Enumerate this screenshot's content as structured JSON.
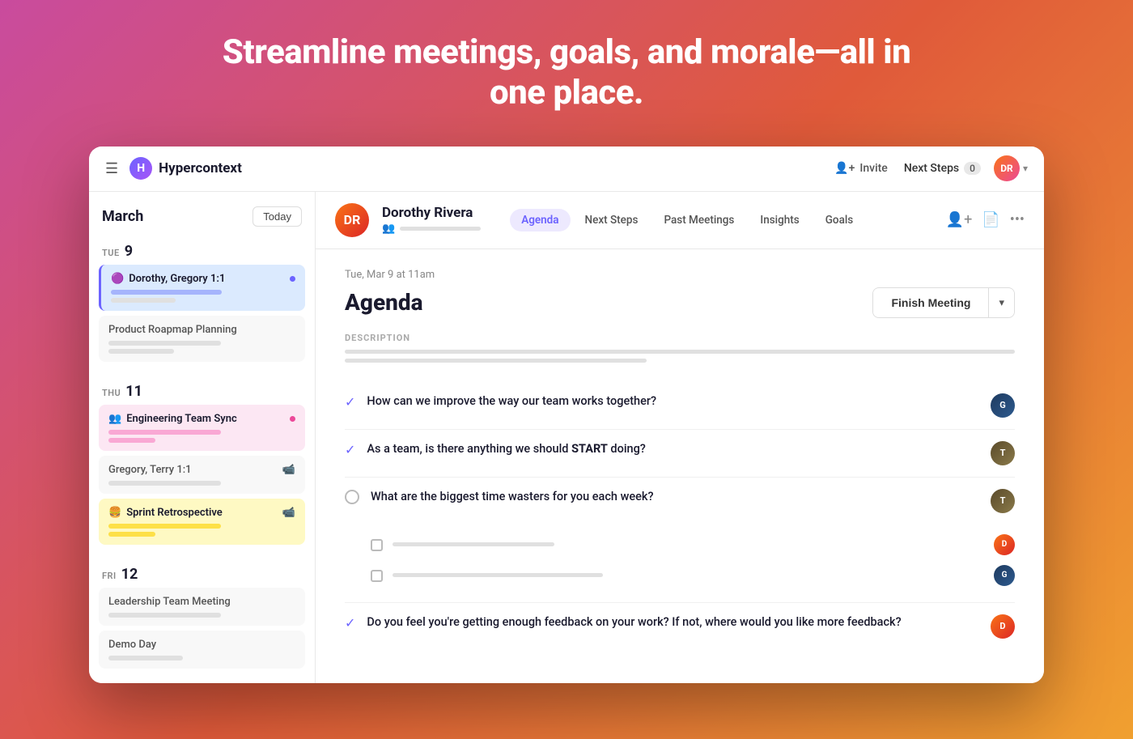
{
  "hero": {
    "title": "Streamline meetings, goals, and morale—all in one place."
  },
  "nav": {
    "logo_text": "Hypercontext",
    "invite_label": "Invite",
    "next_steps_label": "Next Steps",
    "next_steps_count": "0",
    "avatar_initials": "DR"
  },
  "sidebar": {
    "month": "March",
    "today_label": "Today",
    "days": [
      {
        "day_label": "TUE",
        "day_number": "9",
        "meetings": [
          {
            "title": "Dorothy, Gregory 1:1",
            "emoji": "🟣",
            "style": "active",
            "has_dot": true
          },
          {
            "title": "Product Roapmap Planning",
            "emoji": "",
            "style": "light",
            "has_dot": false
          }
        ]
      },
      {
        "day_label": "THU",
        "day_number": "11",
        "meetings": [
          {
            "title": "Engineering Team Sync",
            "emoji": "👥",
            "style": "pink",
            "has_dot": true
          },
          {
            "title": "Gregory, Terry 1:1",
            "emoji": "",
            "style": "light",
            "has_dot": false,
            "has_video": true
          },
          {
            "title": "Sprint Retrospective",
            "emoji": "🍔",
            "style": "yellow",
            "has_dot": false,
            "has_video": true
          }
        ]
      },
      {
        "day_label": "FRI",
        "day_number": "12",
        "meetings": [
          {
            "title": "Leadership Team Meeting",
            "emoji": "",
            "style": "light",
            "has_dot": false
          },
          {
            "title": "Demo Day",
            "emoji": "",
            "style": "light",
            "has_dot": false
          }
        ]
      }
    ]
  },
  "meeting": {
    "person_name": "Dorothy Rivera",
    "avatar_initials": "DR",
    "tabs": [
      "Agenda",
      "Next Steps",
      "Past Meetings",
      "Insights",
      "Goals"
    ],
    "active_tab": "Agenda",
    "date": "Tue, Mar 9 at 11am",
    "title": "Agenda",
    "finish_btn_label": "Finish Meeting",
    "description_label": "DESCRIPTION",
    "agenda_items": [
      {
        "type": "check",
        "text": "How can we improve the way our team works together?",
        "avatar_class": "av1"
      },
      {
        "type": "check",
        "text": "As a team, is there anything we should START doing?",
        "avatar_class": "av2"
      },
      {
        "type": "circle",
        "text": "What are the biggest time wasters for you each week?",
        "avatar_class": "av3",
        "has_subitems": true
      },
      {
        "type": "check",
        "text": "Do you feel you're getting enough feedback on your work? If not, where would you like more feedback?",
        "avatar_class": "av6"
      }
    ]
  }
}
